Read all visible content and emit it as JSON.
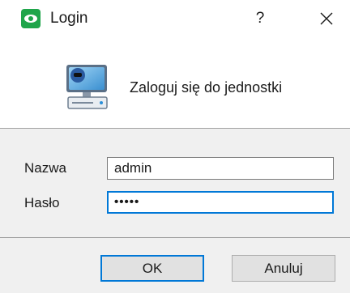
{
  "window": {
    "title": "Login",
    "help_label": "?"
  },
  "header": {
    "message": "Zaloguj się do jednostki"
  },
  "form": {
    "username_label": "Nazwa",
    "username_value": "admin",
    "password_label": "Hasło",
    "password_value": "•••••"
  },
  "buttons": {
    "ok_label": "OK",
    "cancel_label": "Anuluj"
  },
  "colors": {
    "brand": "#1fa54a",
    "focus": "#0078d7"
  },
  "icons": {
    "app": "eye-icon",
    "header": "computer-icon",
    "close": "close-icon"
  }
}
